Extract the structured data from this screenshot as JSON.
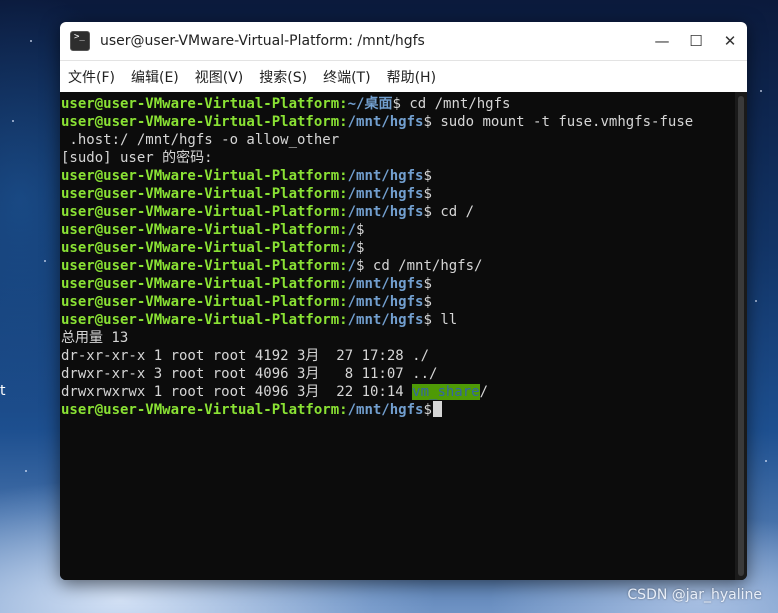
{
  "window": {
    "title": "user@user-VMware-Virtual-Platform: /mnt/hgfs",
    "icon": "terminal-icon",
    "controls": {
      "minimize": "—",
      "maximize": "☐",
      "close": "✕"
    }
  },
  "menu": [
    "文件(F)",
    "编辑(E)",
    "视图(V)",
    "搜索(S)",
    "终端(T)",
    "帮助(H)"
  ],
  "prompt_user": "user@user-VMware-Virtual-Platform",
  "terminal": {
    "lines": [
      {
        "type": "prompt",
        "path": "~/桌面",
        "cmd": " cd /mnt/hgfs"
      },
      {
        "type": "prompt",
        "path": "/mnt/hgfs",
        "cmd": " sudo mount -t fuse.vmhgfs-fuse"
      },
      {
        "type": "text",
        "text": " .host:/ /mnt/hgfs -o allow_other"
      },
      {
        "type": "text",
        "text": "[sudo] user 的密码:"
      },
      {
        "type": "prompt",
        "path": "/mnt/hgfs",
        "cmd": ""
      },
      {
        "type": "prompt",
        "path": "/mnt/hgfs",
        "cmd": ""
      },
      {
        "type": "prompt",
        "path": "/mnt/hgfs",
        "cmd": " cd /"
      },
      {
        "type": "prompt",
        "path": "/",
        "cmd": ""
      },
      {
        "type": "prompt",
        "path": "/",
        "cmd": ""
      },
      {
        "type": "prompt",
        "path": "/",
        "cmd": " cd /mnt/hgfs/"
      },
      {
        "type": "prompt",
        "path": "/mnt/hgfs",
        "cmd": ""
      },
      {
        "type": "prompt",
        "path": "/mnt/hgfs",
        "cmd": ""
      },
      {
        "type": "prompt",
        "path": "/mnt/hgfs",
        "cmd": " ll"
      },
      {
        "type": "text",
        "text": "总用量 13"
      },
      {
        "type": "text",
        "text": "dr-xr-xr-x 1 root root 4192 3月  27 17:28 ./"
      },
      {
        "type": "text",
        "text": "drwxr-xr-x 3 root root 4096 3月   8 11:07 ../"
      },
      {
        "type": "ls",
        "prefix": "drwxrwxrwx 1 root root 4096 3月  22 10:14 ",
        "name": "vm_share",
        "suffix": "/"
      },
      {
        "type": "prompt",
        "path": "/mnt/hgfs",
        "cmd": "",
        "cursor": true
      }
    ]
  },
  "desktop": {
    "edge_letter": "t",
    "watermark": "CSDN @jar_hyaline"
  },
  "colors": {
    "prompt_user": "#8ae234",
    "prompt_path": "#729fcf",
    "highlight_bg": "#4e9a06",
    "highlight_fg": "#3465a4"
  }
}
